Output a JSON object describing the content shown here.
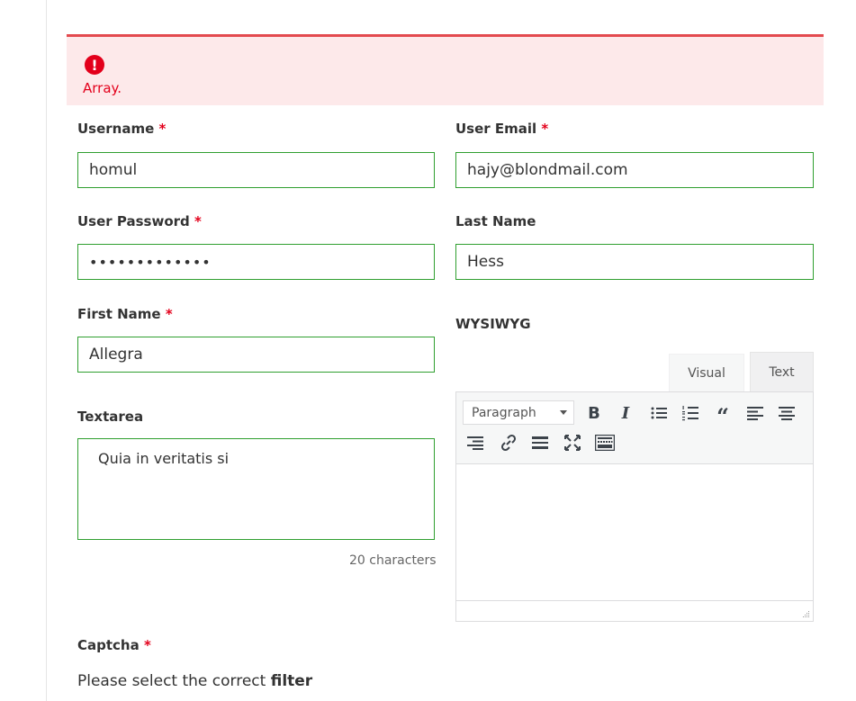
{
  "alert": {
    "message": "Array.",
    "icon": "exclamation-icon",
    "color": "#e3001b",
    "background": "#fde9ea"
  },
  "required_mark": "*",
  "fields": {
    "username": {
      "label": "Username",
      "value": "homul"
    },
    "user_email": {
      "label": "User Email",
      "value": "hajy@blondmail.com"
    },
    "user_password": {
      "label": "User Password",
      "value": "•••••••••••••"
    },
    "last_name": {
      "label": "Last Name",
      "value": "Hess"
    },
    "first_name": {
      "label": "First Name",
      "value": "Allegra"
    },
    "wysiwyg": {
      "label": "WYSIWYG"
    },
    "textarea": {
      "label": "Textarea",
      "value": "Quia in veritatis si",
      "char_count": "20 characters"
    },
    "captcha": {
      "label": "Captcha",
      "prompt": "Please select the correct",
      "prompt_emphasis": "filter"
    }
  },
  "editor": {
    "tabs": {
      "visual": "Visual",
      "text": "Text"
    },
    "format_select": "Paragraph",
    "buttons": {
      "bold": "B",
      "italic": "I",
      "quote": "“"
    }
  },
  "colors": {
    "field_border": "#2f9f2f",
    "required": "#e3001b",
    "alert_border": "#e34a4f"
  }
}
